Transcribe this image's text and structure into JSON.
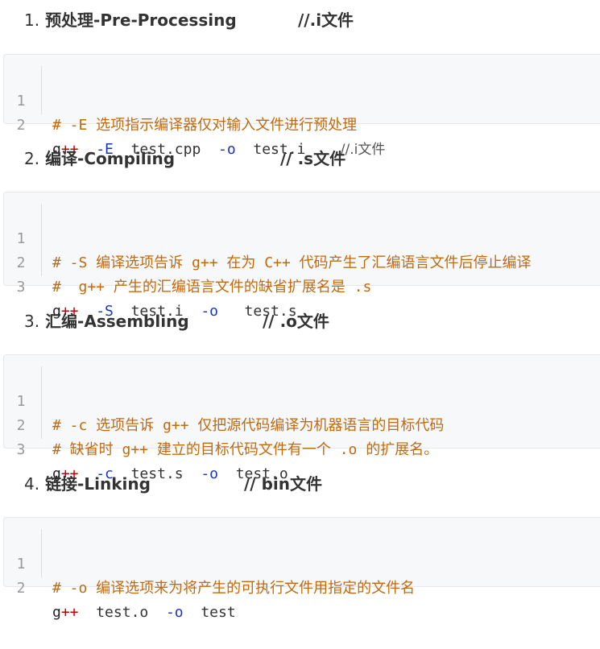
{
  "sections": [
    {
      "heading": {
        "number": "1.",
        "title": "预处理-Pre-Processing",
        "note": "//.i文件"
      },
      "lines": [
        {
          "n": "1",
          "comment": "# -E 选项指示编译器仅对输入文件进行预处理"
        },
        {
          "n": "2",
          "cmd": "g",
          "plus": "++",
          "flag1": "-E",
          "arg1": "test.cpp",
          "flag2": "-o",
          "arg2": "test.i",
          "note": "//.i文件"
        }
      ]
    },
    {
      "heading": {
        "number": "2.",
        "title": "编译-Compiling",
        "note": "// .s文件"
      },
      "lines": [
        {
          "n": "1",
          "comment": "# -S 编译选项告诉 g++ 在为 C++ 代码产生了汇编语言文件后停止编译"
        },
        {
          "n": "2",
          "comment": "#  g++ 产生的汇编语言文件的缺省扩展名是 .s"
        },
        {
          "n": "3",
          "cmd": "g",
          "plus": "++",
          "flag1": "-S",
          "arg1": "test.i",
          "flag2": "-o",
          "arg2": "test.s"
        }
      ]
    },
    {
      "heading": {
        "number": "3.",
        "title": "汇编-Assembling",
        "note": "// .o文件"
      },
      "lines": [
        {
          "n": "1",
          "comment": "# -c 选项告诉 g++ 仅把源代码编译为机器语言的目标代码"
        },
        {
          "n": "2",
          "comment": "# 缺省时 g++ 建立的目标代码文件有一个 .o 的扩展名。"
        },
        {
          "n": "3",
          "cmd": "g",
          "plus": "++",
          "flag1": "-c",
          "arg1": "test.s",
          "flag2": "-o",
          "arg2": "test.o"
        }
      ]
    },
    {
      "heading": {
        "number": "4.",
        "title": "链接-Linking",
        "note": "// bin文件"
      },
      "lines": [
        {
          "n": "1",
          "comment": "# -o 编译选项来为将产生的可执行文件用指定的文件名"
        },
        {
          "n": "2",
          "cmd": "g",
          "plus": "++",
          "arg1": "test.o",
          "flag2": "-o",
          "arg2": "test"
        }
      ]
    }
  ]
}
